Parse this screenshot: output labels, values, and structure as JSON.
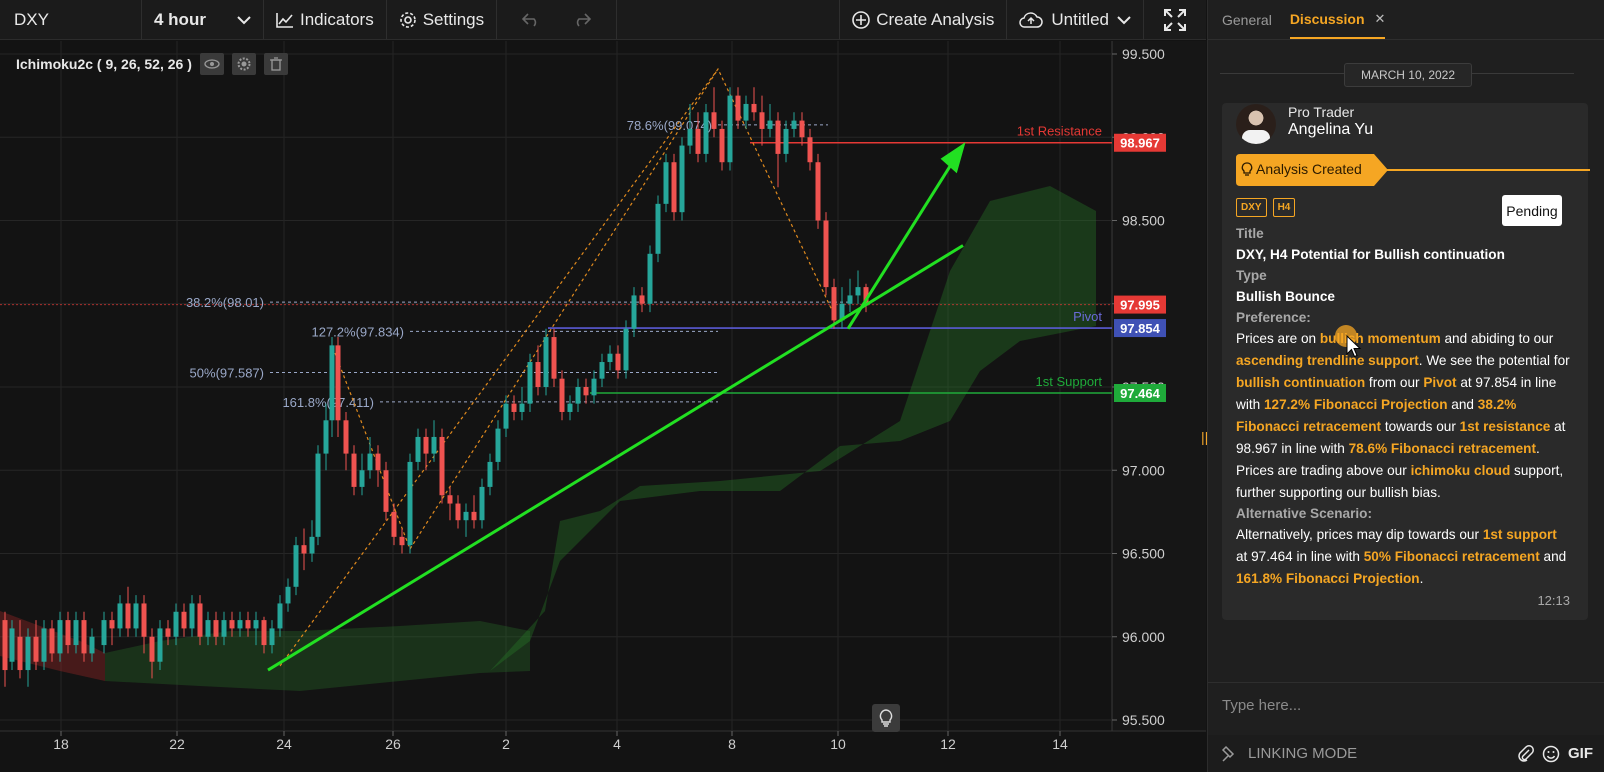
{
  "toolbar": {
    "symbol": "DXY",
    "interval": "4 hour",
    "indicators": "Indicators",
    "settings": "Settings",
    "create_analysis": "Create Analysis",
    "layout_name": "Untitled"
  },
  "study": {
    "label": "Ichimoku2c ( 9, 26, 52, 26 )"
  },
  "chart_data": {
    "type": "candlestick",
    "y_ticks": [
      "99.500",
      "99.000",
      "98.500",
      "98.000",
      "97.500",
      "97.000",
      "96.500",
      "96.000",
      "95.500"
    ],
    "ylim": [
      95.5,
      99.5
    ],
    "x_ticks": [
      "18",
      "22",
      "24",
      "26",
      "2",
      "4",
      "8",
      "10",
      "12",
      "14"
    ],
    "price_tags": [
      {
        "value": "98.967",
        "color": "#e53935"
      },
      {
        "value": "97.995",
        "color": "#e53935"
      },
      {
        "value": "97.854",
        "color": "#3f51b5"
      },
      {
        "value": "97.464",
        "color": "#1faa3a"
      }
    ],
    "levels": [
      {
        "label": "1st Resistance",
        "value": 98.967,
        "color": "#e53935"
      },
      {
        "label": "Pivot",
        "value": 97.854,
        "color": "#6a6ad8"
      },
      {
        "label": "1st Support",
        "value": 97.464,
        "color": "#1faa3a"
      }
    ],
    "fib_labels": [
      {
        "label": "78.6%(99.074)",
        "value": 99.074
      },
      {
        "label": "38.2%(98.01)",
        "value": 98.01
      },
      {
        "label": "127.2%(97.834)",
        "value": 97.834
      },
      {
        "label": "50%(97.587)",
        "value": 97.587
      },
      {
        "label": "161.8%(97.411)",
        "value": 97.411
      }
    ]
  },
  "panel": {
    "tabs": [
      "General",
      "Discussion"
    ],
    "date": "MARCH 10, 2022",
    "author_role": "Pro Trader",
    "author_name": "Angelina Yu",
    "status": "Analysis Created",
    "tags": [
      "DXY",
      "H4"
    ],
    "pending": "Pending",
    "title_label": "Title",
    "title": "DXY, H4 Potential for Bullish continuation",
    "type_label": "Type",
    "type": "Bullish Bounce",
    "preference_label": "Preference:",
    "preference": [
      {
        "t": "Prices are on ",
        "h": false
      },
      {
        "t": "bullish momentum",
        "h": true
      },
      {
        "t": " and abiding to our ",
        "h": false
      },
      {
        "t": "ascending trendline support",
        "h": true
      },
      {
        "t": ". We see the potential for ",
        "h": false
      },
      {
        "t": "bullish continuation",
        "h": true
      },
      {
        "t": " from our ",
        "h": false
      },
      {
        "t": "Pivot",
        "h": true
      },
      {
        "t": " at 97.854 in line with ",
        "h": false
      },
      {
        "t": "127.2% Fibonacci Projection",
        "h": true
      },
      {
        "t": " and ",
        "h": false
      },
      {
        "t": "38.2% Fibonacci retracement",
        "h": true
      },
      {
        "t": " towards our ",
        "h": false
      },
      {
        "t": "1st resistance",
        "h": true
      },
      {
        "t": " at 98.967 in line with ",
        "h": false
      },
      {
        "t": "78.6% Fibonacci retracement",
        "h": true
      },
      {
        "t": ". Prices are trading above our ",
        "h": false
      },
      {
        "t": "ichimoku cloud",
        "h": true
      },
      {
        "t": " support, further supporting our bullish bias.",
        "h": false
      }
    ],
    "alt_label": "Alternative Scenario:",
    "alternative": [
      {
        "t": "Alternatively, prices may dip towards our ",
        "h": false
      },
      {
        "t": "1st support",
        "h": true
      },
      {
        "t": " at 97.464 in line with ",
        "h": false
      },
      {
        "t": "50% Fibonacci retracement",
        "h": true
      },
      {
        "t": " and ",
        "h": false
      },
      {
        "t": "161.8% Fibonacci Projection",
        "h": true
      },
      {
        "t": ".",
        "h": false
      }
    ],
    "time": "12:13",
    "input_placeholder": "Type here...",
    "linking_mode": "LINKING MODE",
    "gif": "GIF"
  }
}
